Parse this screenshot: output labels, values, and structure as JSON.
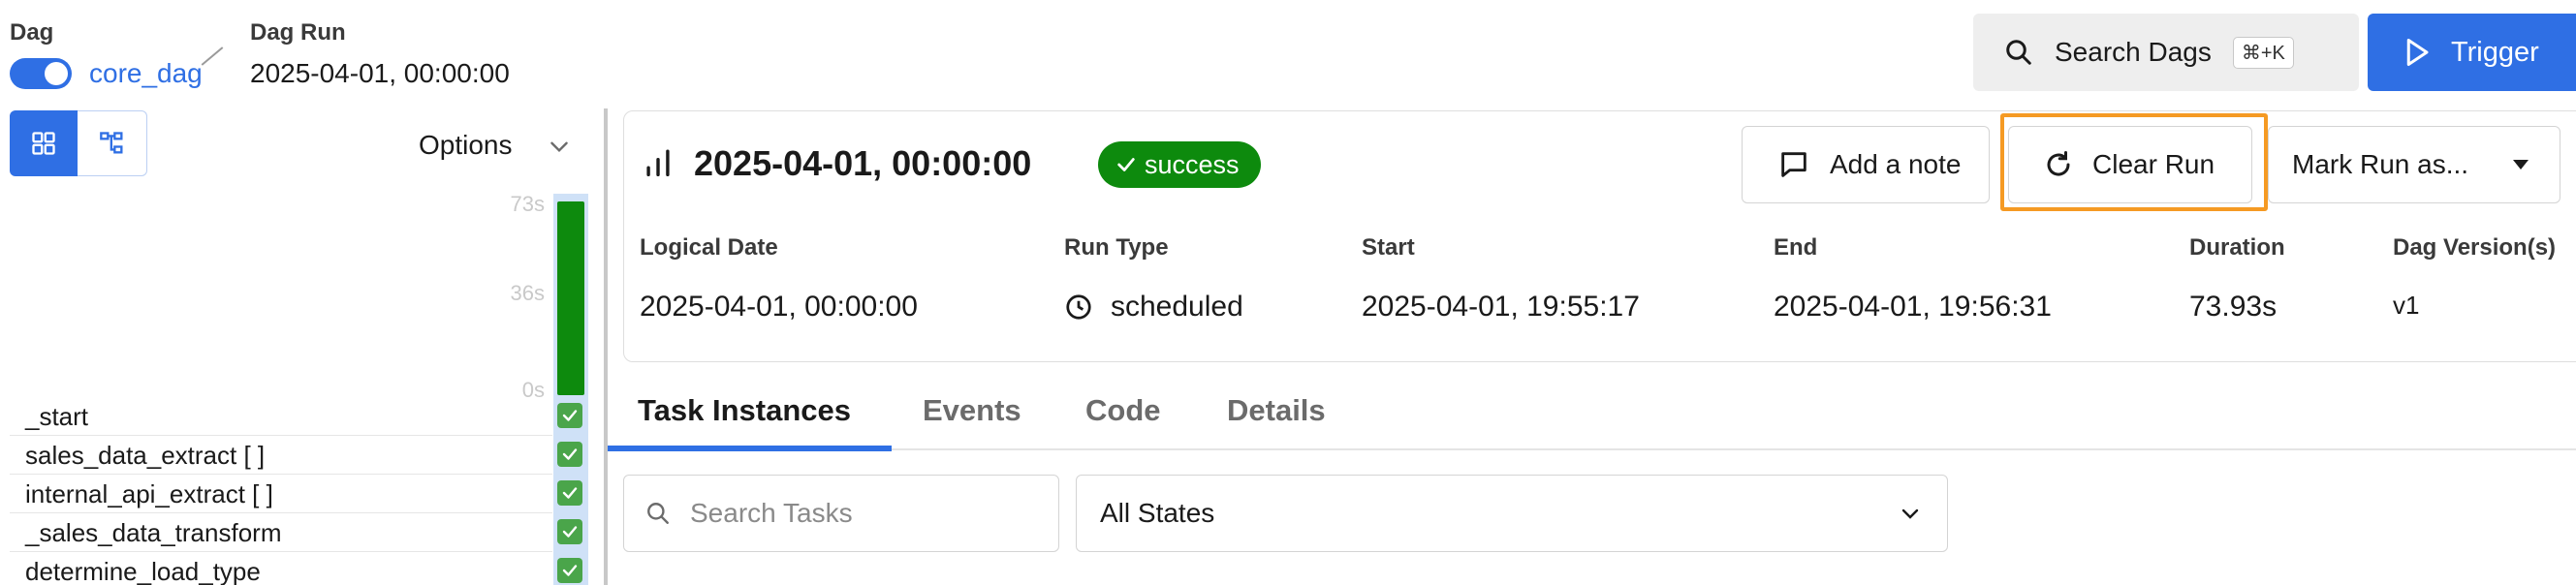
{
  "header": {
    "dag_label": "Dag",
    "dag_name": "core_dag",
    "dag_run_label": "Dag Run",
    "dag_run_value": "2025-04-01, 00:00:00",
    "search_label": "Search Dags",
    "search_shortcut": "⌘+K",
    "trigger_label": "Trigger"
  },
  "left_panel": {
    "options_label": "Options",
    "y_ticks": [
      "73s",
      "36s",
      "0s"
    ],
    "duration_fraction": 1.0,
    "tasks": [
      {
        "name": "_start",
        "state": "success"
      },
      {
        "name": "sales_data_extract [ ]",
        "state": "success"
      },
      {
        "name": "internal_api_extract [ ]",
        "state": "success"
      },
      {
        "name": "_sales_data_transform",
        "state": "success"
      },
      {
        "name": "determine_load_type",
        "state": "success"
      }
    ]
  },
  "run": {
    "title": "2025-04-01, 00:00:00",
    "status": "success",
    "add_note_label": "Add a note",
    "clear_run_label": "Clear Run",
    "mark_run_label": "Mark Run as...",
    "meta": {
      "logical_date_label": "Logical Date",
      "logical_date": "2025-04-01, 00:00:00",
      "run_type_label": "Run Type",
      "run_type": "scheduled",
      "start_label": "Start",
      "start": "2025-04-01, 19:55:17",
      "end_label": "End",
      "end": "2025-04-01, 19:56:31",
      "duration_label": "Duration",
      "duration": "73.93s",
      "dag_version_label": "Dag Version(s)",
      "dag_version": "v1"
    }
  },
  "tabs": [
    {
      "label": "Task Instances",
      "active": true
    },
    {
      "label": "Events",
      "active": false
    },
    {
      "label": "Code",
      "active": false
    },
    {
      "label": "Details",
      "active": false
    }
  ],
  "filters": {
    "search_placeholder": "Search Tasks",
    "state_value": "All States"
  },
  "colors": {
    "accent": "#2f6fe4",
    "success": "#0d8a0d",
    "highlight": "#f59a23"
  }
}
